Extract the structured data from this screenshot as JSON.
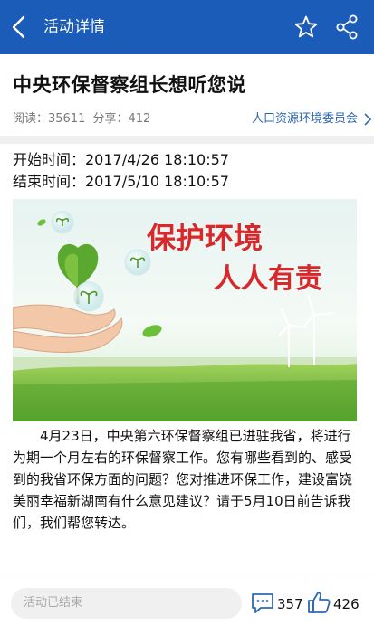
{
  "appbar": {
    "title": "活动详情",
    "icons": [
      "back-arrow-icon",
      "star-icon",
      "share-icon"
    ],
    "background_color": "#1a5cb8"
  },
  "article": {
    "title": "中央环保督察组长想听您说",
    "read_label": "阅读：35611",
    "share_label": "分享：412",
    "committee": "人口资源环境委员会",
    "start_time": "开始时间：2017/4/26 18:10:57",
    "end_time": "结束时间：2017/5/10 18:10:57",
    "banner": {
      "line1": "保护环境",
      "line2": "人人有责"
    },
    "body": "4月23日，中央第六环保督察组已进驻我省，将进行为期一个月左右的环保督察工作。您有哪些看到的、感受到的我省环保方面的问题？您对推进环保工作，建设富饶美丽幸福新湖南有什么意见建议？请于5月10日前告诉我们，我们帮您转达。"
  },
  "bottombar": {
    "status": "活动已结束",
    "comment_count": "357",
    "like_count": "426"
  },
  "colors": {
    "accent": "#1a5cb8",
    "link": "#2f67b3",
    "banner_text": "#d8282b"
  }
}
